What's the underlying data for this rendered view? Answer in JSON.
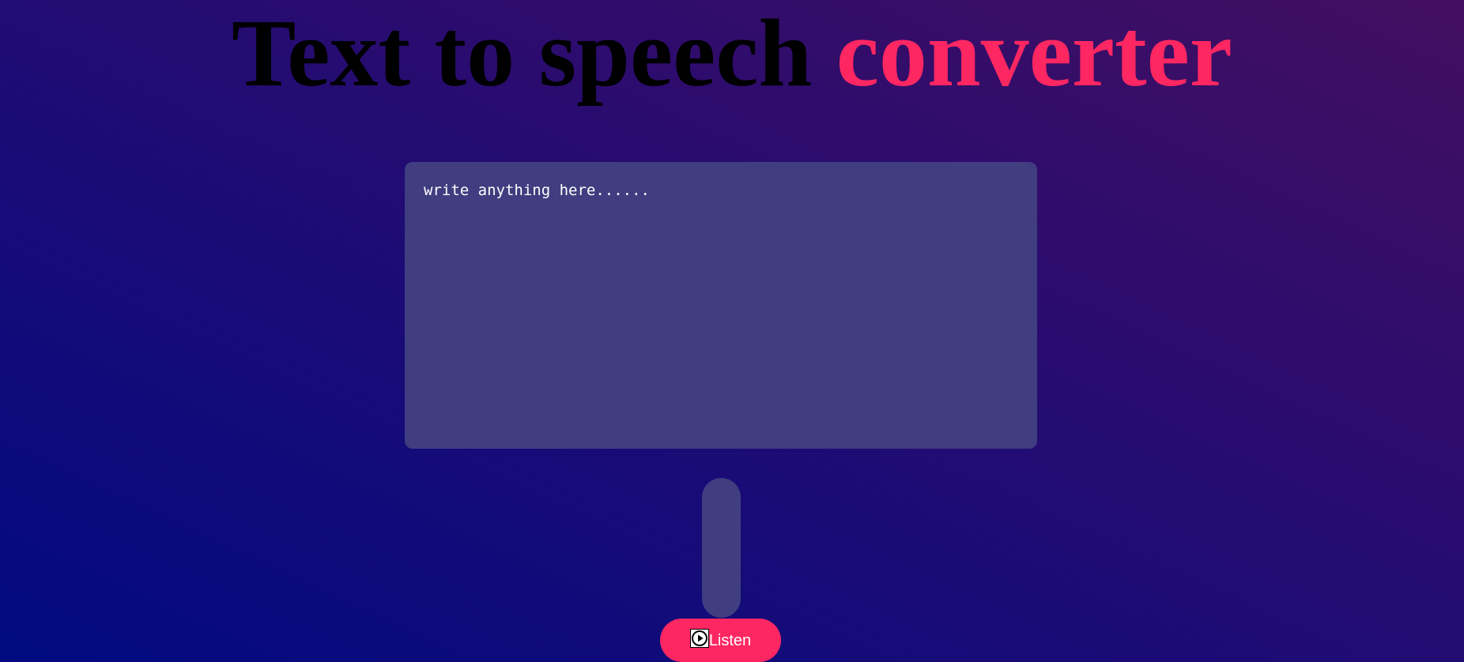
{
  "header": {
    "title_main": "Text to speech ",
    "title_accent": "converter"
  },
  "editor": {
    "placeholder": "write anything here......",
    "value": ""
  },
  "voice_select": {
    "selected": ""
  },
  "listen_button": {
    "label": "Listen",
    "icon": "play-circle-icon"
  },
  "colors": {
    "accent": "#ff2762",
    "panel": "#403d80",
    "title": "#000000",
    "background_start": "#010a80",
    "background_end": "#430f60"
  }
}
